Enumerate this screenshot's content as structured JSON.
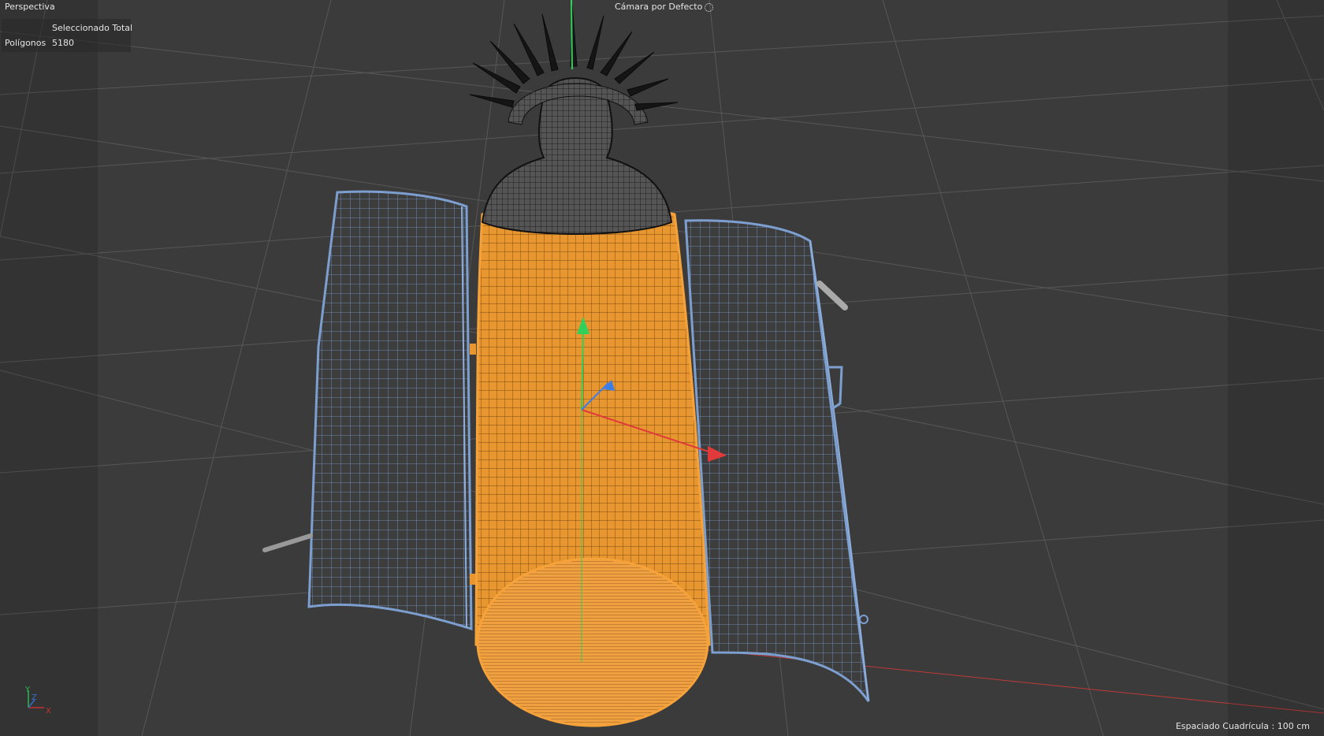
{
  "viewport": {
    "view_name": "Perspectiva",
    "camera": "Cámara por Defecto",
    "camera_icon": "camera-dot-icon",
    "hud": {
      "header": "Seleccionado Total",
      "polygons_label": "Polígonos",
      "polygons_value": "5180"
    },
    "grid_spacing": "Espaciado Cuadrícula : 100 cm",
    "axes": {
      "y": "Y",
      "z": "Z",
      "x": "X"
    }
  },
  "colors": {
    "background": "#3b3b3b",
    "grid": "#5a5a5a",
    "selected_wireframe": "#f5a23a",
    "selected_fill": "#e8962f",
    "door_wireframe": "#7d9fd0",
    "head_wireframe": "#0c0c0c",
    "axis_x": "#e03a3a",
    "axis_y": "#2fd15a",
    "axis_z": "#3c7ee8"
  },
  "scene": {
    "objects": [
      "torso-cylinder",
      "left-door",
      "right-door",
      "head-bust",
      "spike-crown",
      "door-handle-left",
      "door-handle-right",
      "hinges"
    ]
  }
}
